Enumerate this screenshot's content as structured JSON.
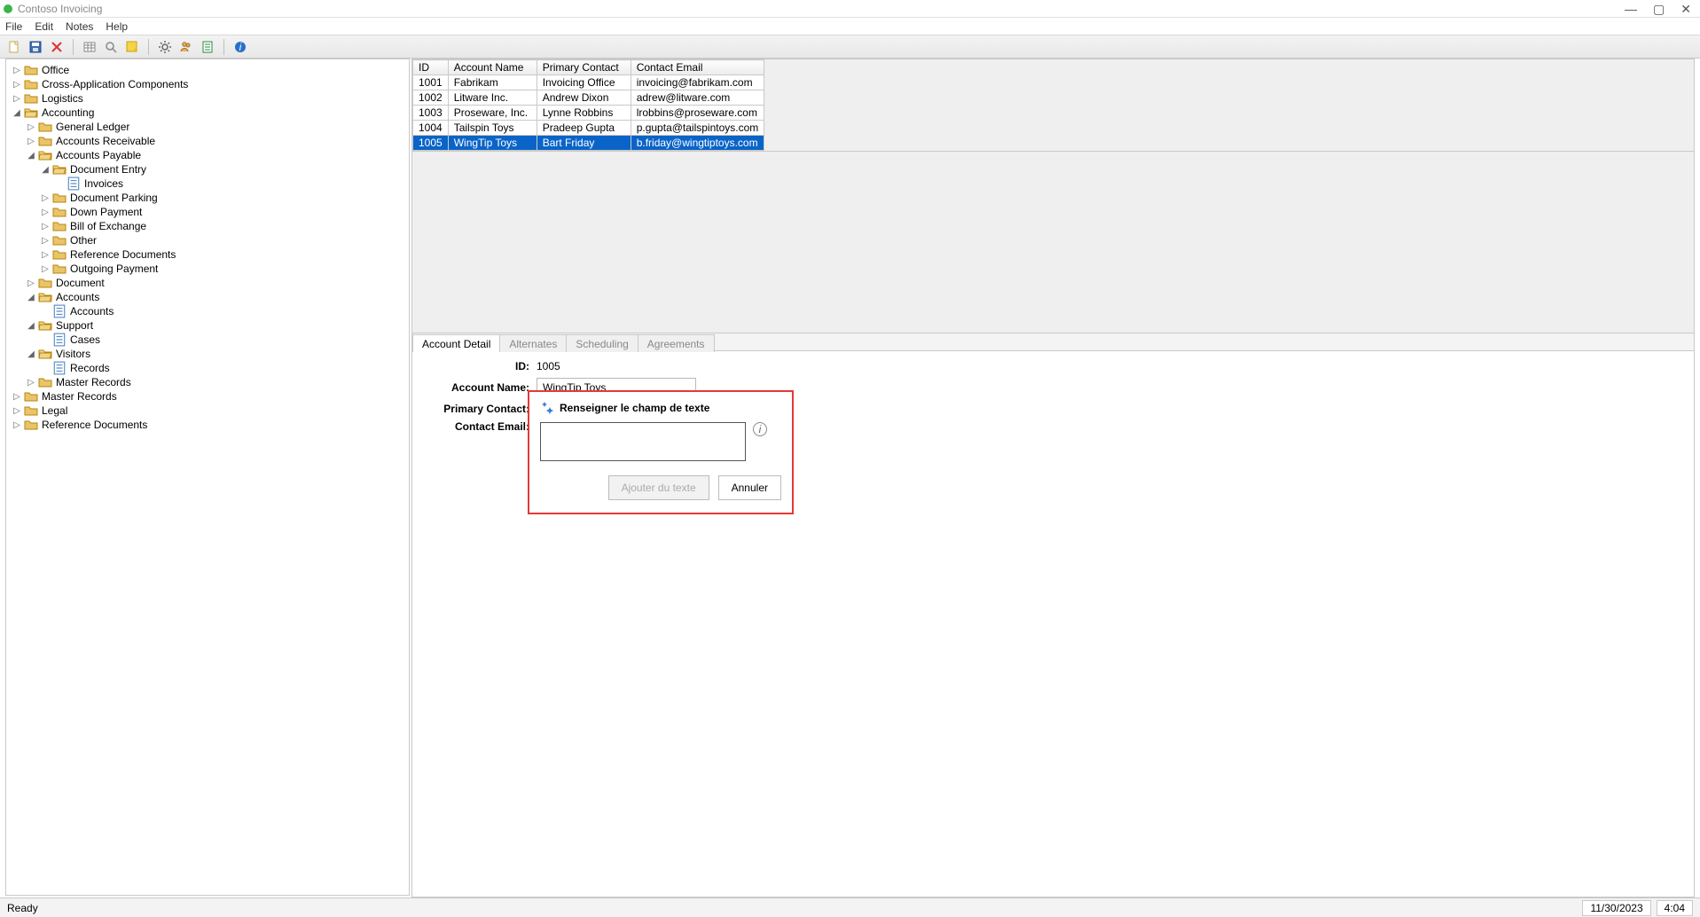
{
  "window": {
    "title": "Contoso Invoicing"
  },
  "menu": {
    "file": "File",
    "edit": "Edit",
    "notes": "Notes",
    "help": "Help"
  },
  "tree": {
    "n0": "Office",
    "n1": "Cross-Application Components",
    "n2": "Logistics",
    "n3": "Accounting",
    "n3_0": "General Ledger",
    "n3_1": "Accounts Receivable",
    "n3_2": "Accounts Payable",
    "n3_2_0": "Document Entry",
    "n3_2_0_0": "Invoices",
    "n3_2_1": "Document Parking",
    "n3_2_2": "Down Payment",
    "n3_2_3": "Bill of Exchange",
    "n3_2_4": "Other",
    "n3_2_5": "Reference Documents",
    "n3_2_6": "Outgoing Payment",
    "n3_3": "Document",
    "n3_4": "Accounts",
    "n3_4_0": "Accounts",
    "n3_5": "Support",
    "n3_5_0": "Cases",
    "n3_6": "Visitors",
    "n3_6_0": "Records",
    "n3_7": "Master Records",
    "n4": "Master Records",
    "n5": "Legal",
    "n6": "Reference Documents"
  },
  "grid": {
    "h_id": "ID",
    "h_name": "Account Name",
    "h_contact": "Primary Contact",
    "h_email": "Contact Email",
    "rows": [
      {
        "id": "1001",
        "name": "Fabrikam",
        "contact": "Invoicing Office",
        "email": "invoicing@fabrikam.com"
      },
      {
        "id": "1002",
        "name": "Litware Inc.",
        "contact": "Andrew Dixon",
        "email": "adrew@litware.com"
      },
      {
        "id": "1003",
        "name": "Proseware, Inc.",
        "contact": "Lynne Robbins",
        "email": "lrobbins@proseware.com"
      },
      {
        "id": "1004",
        "name": "Tailspin Toys",
        "contact": "Pradeep Gupta",
        "email": "p.gupta@tailspintoys.com"
      },
      {
        "id": "1005",
        "name": "WingTip Toys",
        "contact": "Bart Friday",
        "email": "b.friday@wingtiptoys.com"
      }
    ]
  },
  "tabs": {
    "t0": "Account Detail",
    "t1": "Alternates",
    "t2": "Scheduling",
    "t3": "Agreements"
  },
  "form": {
    "l_id": "ID:",
    "v_id": "1005",
    "l_name": "Account Name:",
    "v_name": "WingTip Toys",
    "l_contact": "Primary Contact:",
    "l_email": "Contact Email:"
  },
  "overlay": {
    "title": "Renseigner le champ de texte",
    "btn_add": "Ajouter du texte",
    "btn_cancel": "Annuler"
  },
  "status": {
    "ready": "Ready",
    "date": "11/30/2023",
    "time": "4:04"
  }
}
